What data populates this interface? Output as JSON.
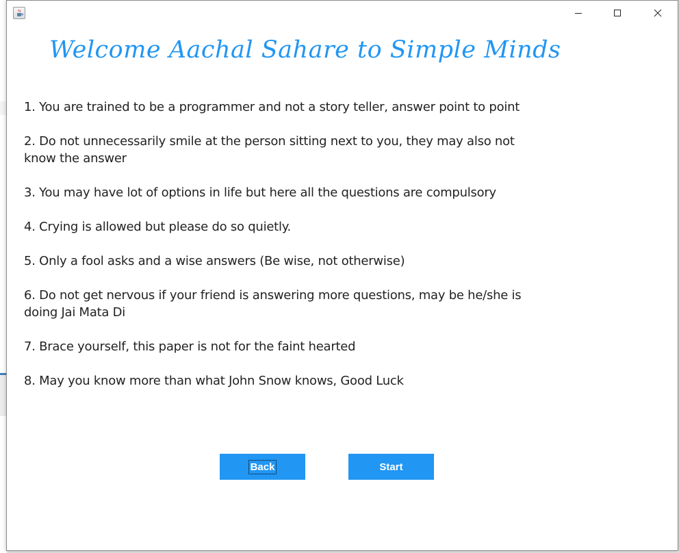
{
  "window": {
    "controls": {
      "minimize_icon": "minimize-icon",
      "maximize_icon": "maximize-icon",
      "close_icon": "close-icon"
    },
    "app_icon": "java-icon"
  },
  "heading": "Welcome Aachal Sahare to Simple Minds",
  "rules": [
    "1. You are trained to be a programmer and not a story teller, answer point to point",
    "2. Do not unnecessarily smile at the person sitting next to you, they may also not know the answer",
    "3. You may have lot of options in life but here all the questions are compulsory",
    "4. Crying is allowed but please do so quietly.",
    "5. Only a fool asks and a wise answers (Be wise, not otherwise)",
    "6. Do not get nervous if your friend is answering more questions, may be he/she is doing Jai Mata Di",
    "7. Brace yourself, this paper is not for the faint hearted",
    "8. May you know more than what John Snow knows, Good Luck"
  ],
  "buttons": {
    "back": "Back",
    "start": "Start"
  },
  "colors": {
    "accent": "#2196f3",
    "text": "#222222",
    "background": "#ffffff"
  }
}
